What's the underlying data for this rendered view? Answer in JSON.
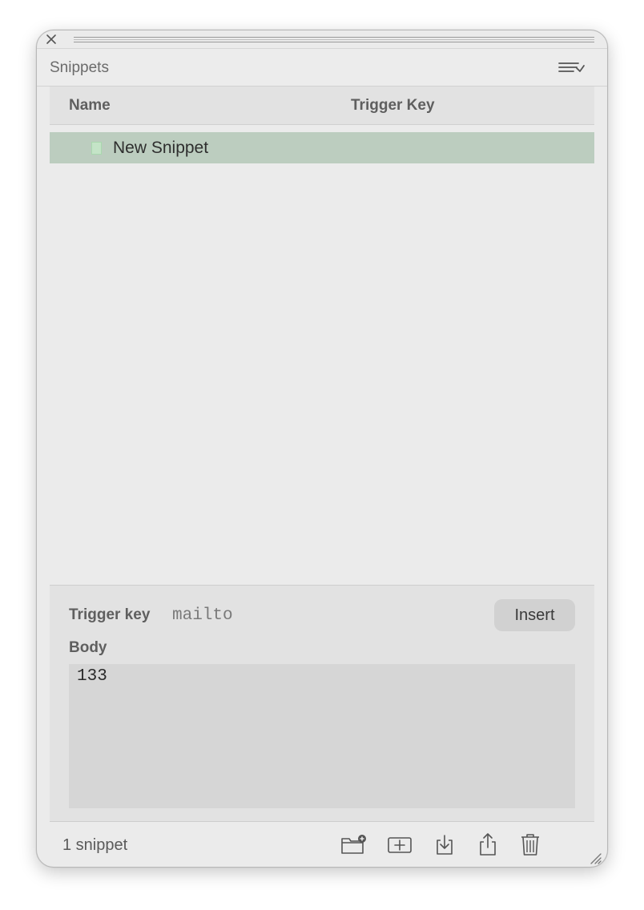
{
  "panel": {
    "title": "Snippets"
  },
  "table": {
    "columns": [
      "Name",
      "Trigger Key"
    ],
    "rows": [
      {
        "name": "New Snippet",
        "trigger": ""
      }
    ]
  },
  "detail": {
    "trigger_label": "Trigger key",
    "trigger_value": "mailto",
    "insert_label": "Insert",
    "body_label": "Body",
    "body_value": "133"
  },
  "footer": {
    "count": "1 snippet",
    "tools": [
      "new-folder-icon",
      "add-snippet-icon",
      "import-icon",
      "share-icon",
      "trash-icon"
    ]
  }
}
